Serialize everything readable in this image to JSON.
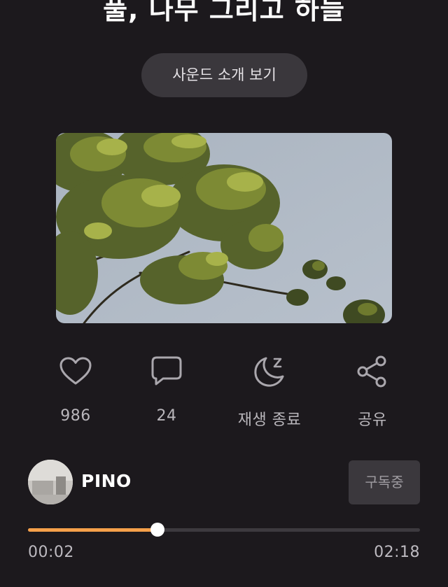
{
  "header": {
    "title": "풀, 나무 그리고 하늘"
  },
  "intro_button": {
    "label": "사운드 소개 보기"
  },
  "actions": {
    "like": {
      "icon": "heart-icon",
      "label": "986"
    },
    "comment": {
      "icon": "comment-icon",
      "label": "24"
    },
    "sleep_timer": {
      "icon": "moon-sleep-icon",
      "label": "재생 종료"
    },
    "share": {
      "icon": "share-icon",
      "label": "공유"
    }
  },
  "creator": {
    "name": "PINO",
    "subscribe_label": "구독중"
  },
  "player": {
    "current_time": "00:02",
    "total_time": "02:18",
    "progress": 0.33
  },
  "colors": {
    "background": "#1c191d",
    "accent": "#f5a04a",
    "button_bg": "#3a373c"
  }
}
